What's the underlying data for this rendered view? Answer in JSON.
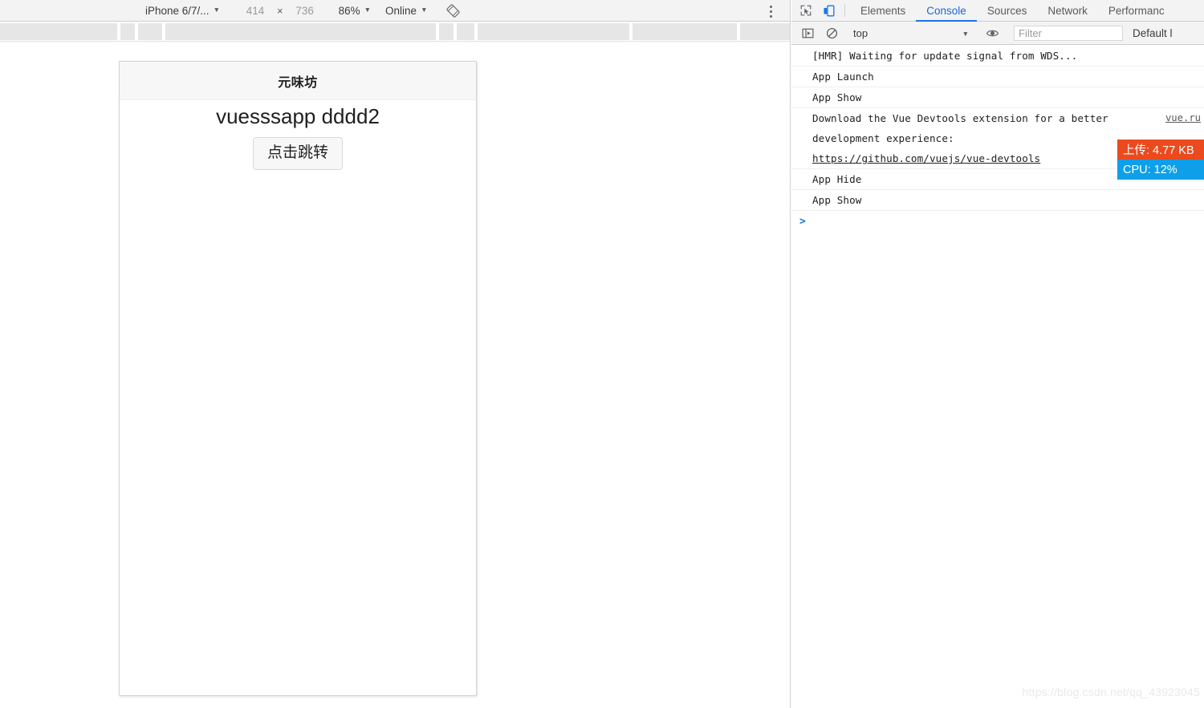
{
  "device_toolbar": {
    "device_name": "iPhone 6/7/...",
    "width": "414",
    "multiply": "×",
    "height": "736",
    "zoom": "86%",
    "throttling": "Online",
    "rotate_icon": "rotate-device-icon",
    "more_icon": "more-options-icon"
  },
  "phone": {
    "header_title": "元味坊",
    "message": "vuesssapp dddd2",
    "button_label": "点击跳转"
  },
  "devtools": {
    "inspect_icon": "inspect-element-icon",
    "device_toggle_icon": "toggle-device-toolbar-icon",
    "tabs": [
      {
        "label": "Elements",
        "active": false
      },
      {
        "label": "Console",
        "active": true
      },
      {
        "label": "Sources",
        "active": false
      },
      {
        "label": "Network",
        "active": false
      },
      {
        "label": "Performanc",
        "active": false
      }
    ],
    "console_toolbar": {
      "sidebar_icon": "console-sidebar-icon",
      "clear_icon": "clear-console-icon",
      "context": "top",
      "eye_icon": "live-expression-eye-icon",
      "filter_placeholder": "Filter",
      "filter_value": "",
      "levels": "Default l"
    },
    "console_rows": [
      {
        "text": "[HMR] Waiting for update signal from WDS...",
        "source": ""
      },
      {
        "text": "App Launch",
        "source": ""
      },
      {
        "text": "App Show",
        "source": ""
      },
      {
        "text": "Download the Vue Devtools extension for a better\ndevelopment experience:",
        "link": "https://github.com/vuejs/vue-devtools",
        "source": "vue.ru"
      },
      {
        "text": "App Hide",
        "source": ""
      },
      {
        "text": "App Show",
        "source": ""
      }
    ],
    "prompt": ">"
  },
  "overlay": {
    "upload_badge": "上传: 4.77 KB",
    "cpu_badge": "CPU: 12%",
    "upload_color": "#ea4a1e",
    "cpu_color": "#0e9fe8"
  },
  "watermark": "https://blog.csdn.net/qq_43923045"
}
